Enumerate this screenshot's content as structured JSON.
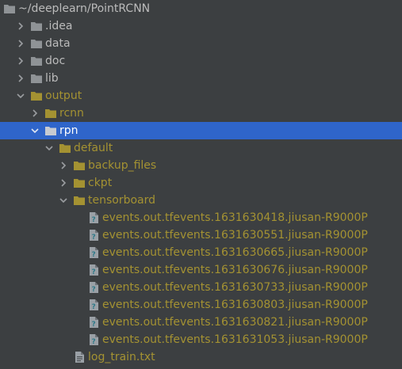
{
  "colors": {
    "background": "#3c3f41",
    "selection": "#2f65ca",
    "text_normal": "#bbbbbb",
    "text_excluded": "#a49232",
    "folder_normal": "#8f9396",
    "folder_excluded": "#a49232",
    "chevron": "#9a9da0"
  },
  "tree": {
    "root": {
      "label": "~/deeplearn/PointRCNN",
      "icon": "folder-icon"
    },
    "idea": {
      "label": ".idea",
      "icon": "folder-icon"
    },
    "data": {
      "label": "data",
      "icon": "folder-icon"
    },
    "doc": {
      "label": "doc",
      "icon": "folder-icon"
    },
    "lib": {
      "label": "lib",
      "icon": "folder-icon"
    },
    "output": {
      "label": "output",
      "icon": "folder-icon"
    },
    "rcnn": {
      "label": "rcnn",
      "icon": "folder-icon"
    },
    "rpn": {
      "label": "rpn",
      "icon": "folder-icon"
    },
    "default": {
      "label": "default",
      "icon": "folder-icon"
    },
    "backup_files": {
      "label": "backup_files",
      "icon": "folder-icon"
    },
    "ckpt": {
      "label": "ckpt",
      "icon": "folder-icon"
    },
    "tensorboard": {
      "label": "tensorboard",
      "icon": "folder-icon"
    },
    "events": [
      {
        "label": "events.out.tfevents.1631630418.jiusan-R9000P",
        "icon": "unknown-file-icon"
      },
      {
        "label": "events.out.tfevents.1631630551.jiusan-R9000P",
        "icon": "unknown-file-icon"
      },
      {
        "label": "events.out.tfevents.1631630665.jiusan-R9000P",
        "icon": "unknown-file-icon"
      },
      {
        "label": "events.out.tfevents.1631630676.jiusan-R9000P",
        "icon": "unknown-file-icon"
      },
      {
        "label": "events.out.tfevents.1631630733.jiusan-R9000P",
        "icon": "unknown-file-icon"
      },
      {
        "label": "events.out.tfevents.1631630803.jiusan-R9000P",
        "icon": "unknown-file-icon"
      },
      {
        "label": "events.out.tfevents.1631630821.jiusan-R9000P",
        "icon": "unknown-file-icon"
      },
      {
        "label": "events.out.tfevents.1631631053.jiusan-R9000P",
        "icon": "unknown-file-icon"
      }
    ],
    "log_train": {
      "label": "log_train.txt",
      "icon": "text-file-icon"
    }
  }
}
